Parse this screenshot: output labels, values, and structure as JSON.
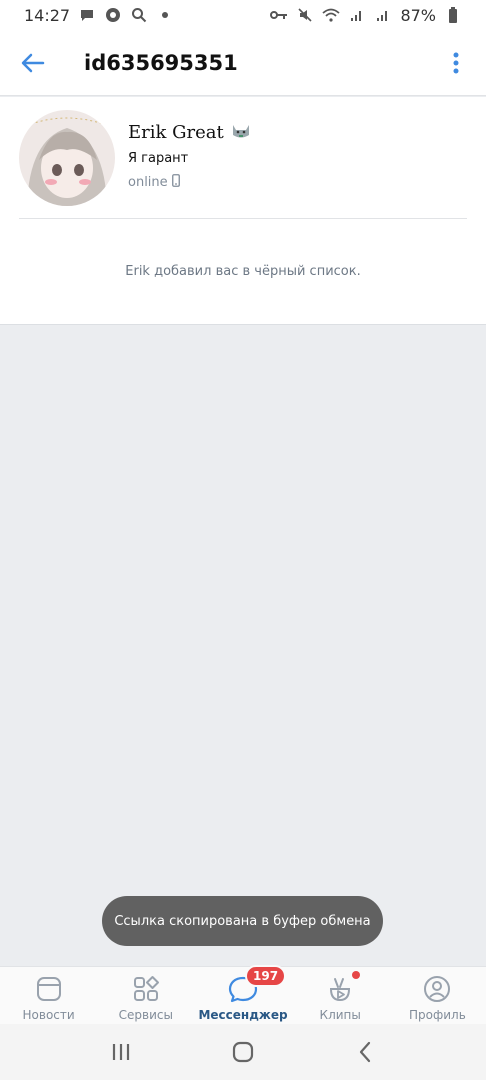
{
  "statusbar": {
    "time": "14:27",
    "battery": "87%"
  },
  "header": {
    "title": "id635695351"
  },
  "profile": {
    "name": "Erik Great",
    "status": "Я гарант",
    "online": "online"
  },
  "notice": {
    "text": "Erik добавил вас в чёрный список."
  },
  "toast": {
    "text": "Ссылка скопирована в буфер обмена"
  },
  "bottom_nav": {
    "items": [
      {
        "label": "Новости",
        "icon": "news-icon"
      },
      {
        "label": "Сервисы",
        "icon": "services-icon"
      },
      {
        "label": "Мессенджер",
        "icon": "messenger-icon",
        "badge": "197"
      },
      {
        "label": "Клипы",
        "icon": "clips-icon"
      },
      {
        "label": "Профиль",
        "icon": "profile-icon"
      }
    ]
  },
  "colors": {
    "accent": "#2a5885",
    "badge": "#e64646",
    "icon_blue": "#3f8ae0"
  }
}
